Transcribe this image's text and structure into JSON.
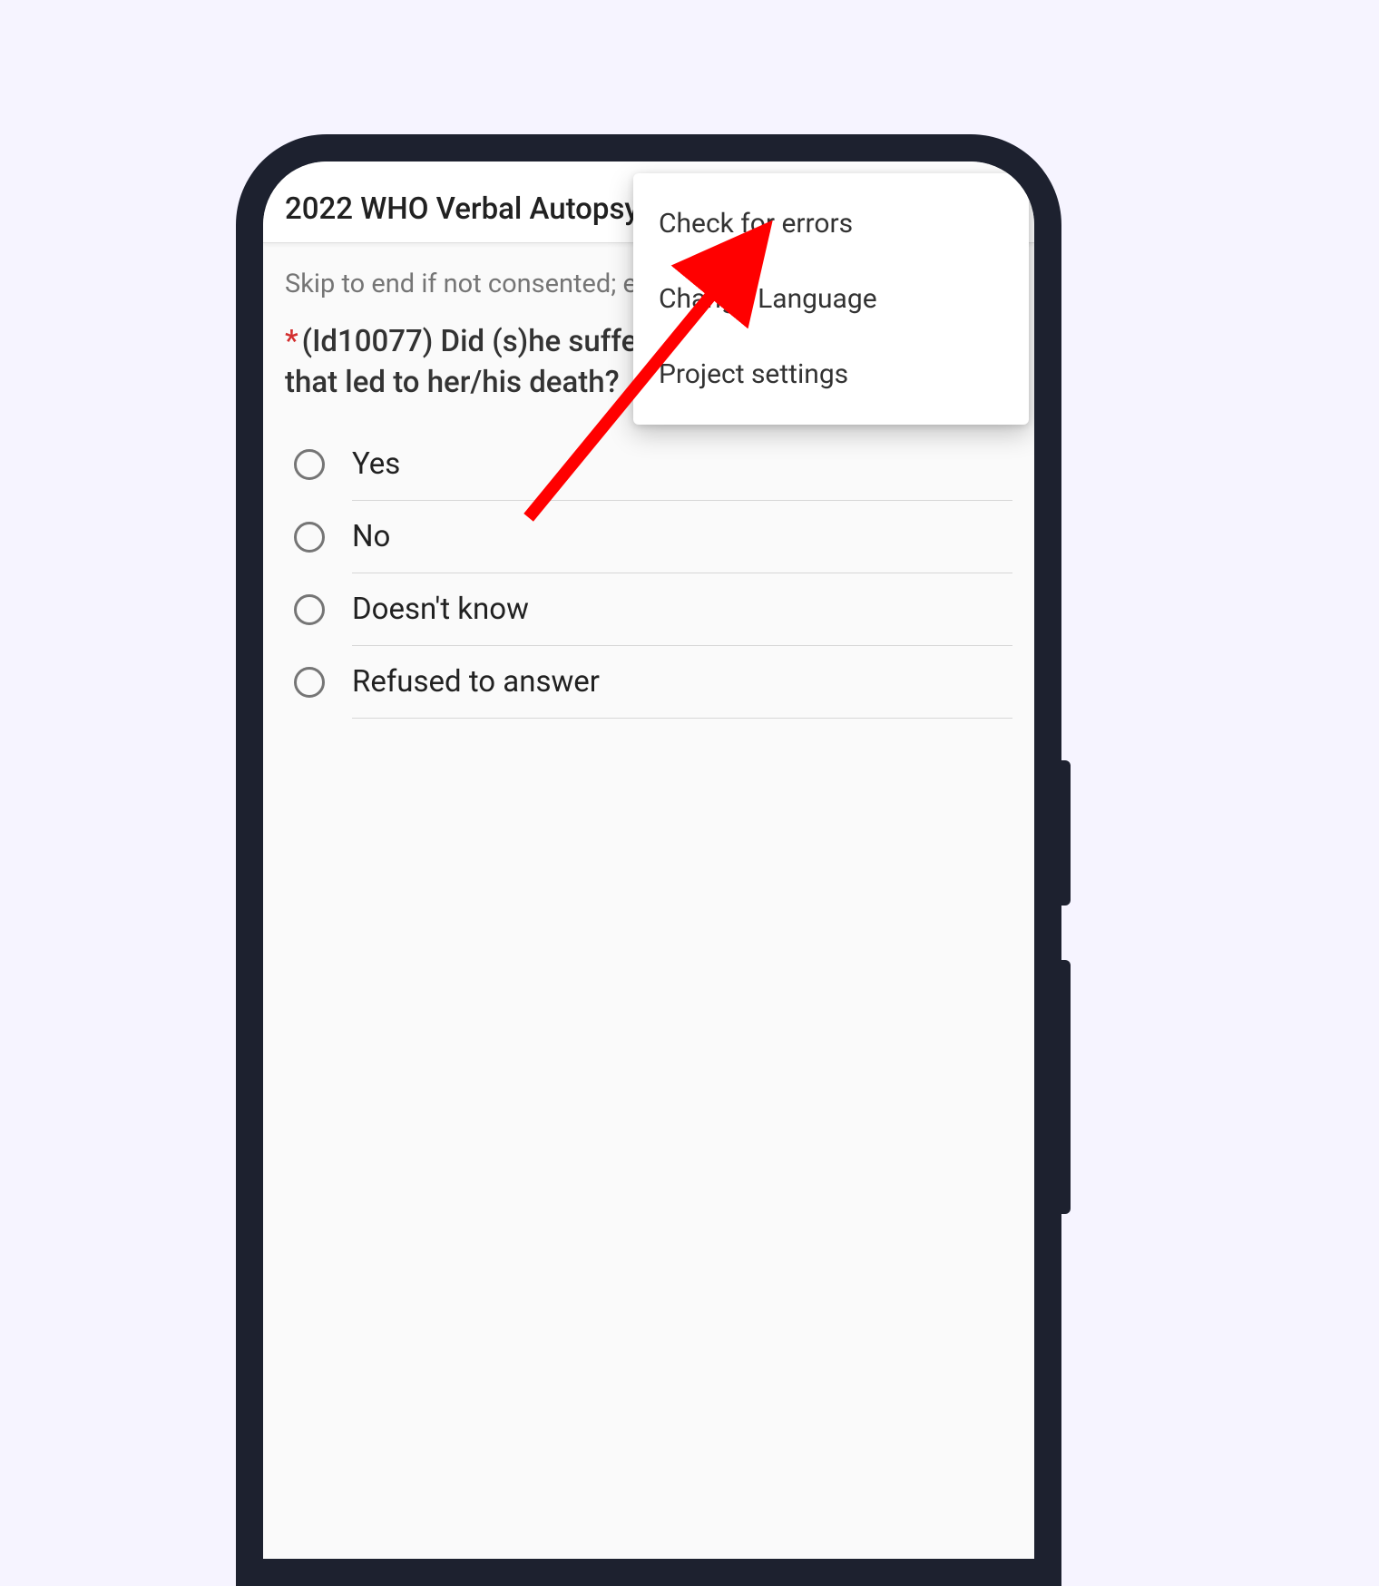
{
  "header": {
    "title": "2022 WHO Verbal Autopsy"
  },
  "form": {
    "note": "Skip to end if not consented; else skip to injuries/accidents",
    "required_marker": "*",
    "question": "(Id10077) Did (s)he suffer from any injury or accident that led to her/his death?",
    "options": [
      {
        "label": "Yes"
      },
      {
        "label": "No"
      },
      {
        "label": "Doesn't know"
      },
      {
        "label": "Refused to answer"
      }
    ]
  },
  "menu": {
    "items": [
      {
        "label": "Check for errors"
      },
      {
        "label": "Change Language"
      },
      {
        "label": "Project settings"
      }
    ]
  },
  "annotation": {
    "color": "#ff0000"
  }
}
